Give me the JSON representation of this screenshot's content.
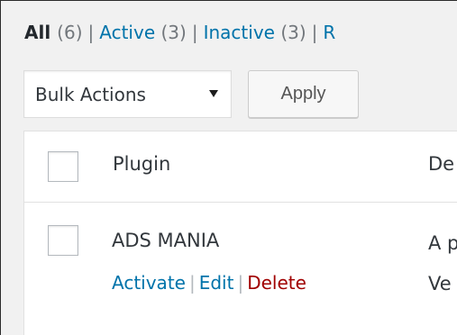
{
  "filters": {
    "all": {
      "label": "All",
      "count": "(6)"
    },
    "active": {
      "label": "Active",
      "count": "(3)"
    },
    "inactive": {
      "label": "Inactive",
      "count": "(3)"
    },
    "separator": "|",
    "partial_next": "R"
  },
  "bulk": {
    "selected": "Bulk Actions",
    "apply_label": "Apply"
  },
  "table": {
    "header": {
      "plugin": "Plugin",
      "description_partial": "De"
    },
    "rows": [
      {
        "name": "ADS MANIA",
        "description_partial_line1": "A p",
        "description_partial_line2": "Ve",
        "actions": {
          "activate": "Activate",
          "edit": "Edit",
          "delete": "Delete",
          "separator": "|"
        }
      }
    ]
  }
}
